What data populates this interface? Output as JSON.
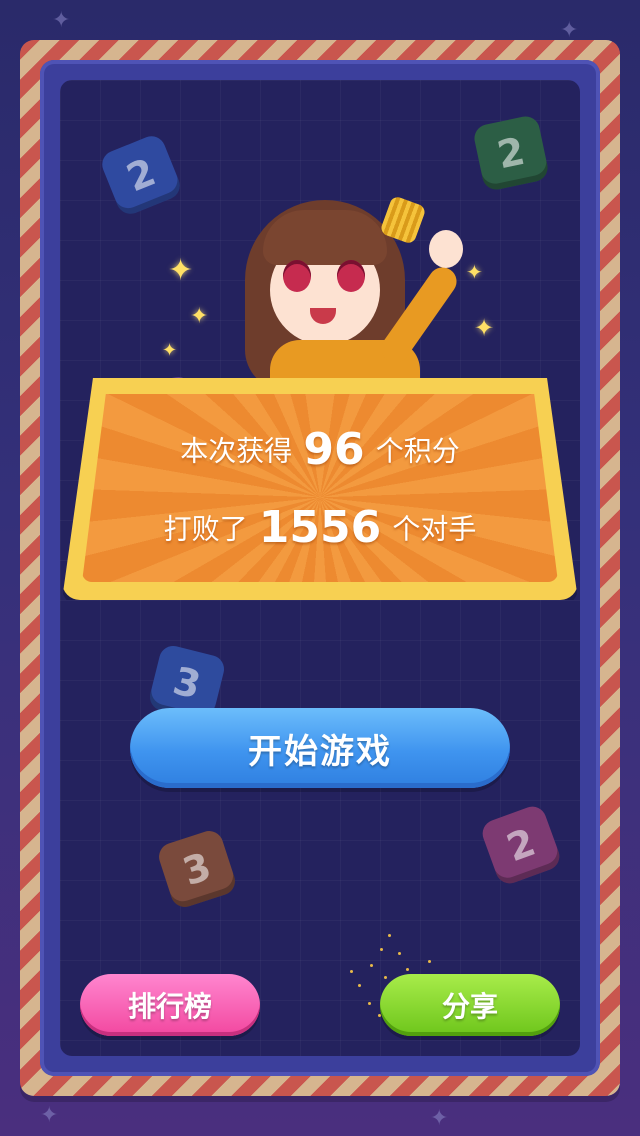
{
  "score_panel": {
    "line1_prefix": "本次获得",
    "points": "96",
    "line1_suffix": "个积分",
    "line2_prefix": "打败了",
    "defeated": "1556",
    "line2_suffix": "个对手"
  },
  "buttons": {
    "start": "开始游戏",
    "leaderboard": "排行榜",
    "share": "分享"
  },
  "tiles": [
    "2",
    "2",
    "3",
    "3",
    "2",
    "2"
  ],
  "colors": {
    "background": "#2a2a6a",
    "board": "#24225e",
    "panel_border": "#f7d052",
    "panel_fill": "#f39a3f",
    "start_button": "#3f94ef",
    "leaderboard_button": "#f2479f",
    "share_button": "#6dc51b"
  },
  "icons": [
    "sparkle-icon",
    "star-icon"
  ]
}
